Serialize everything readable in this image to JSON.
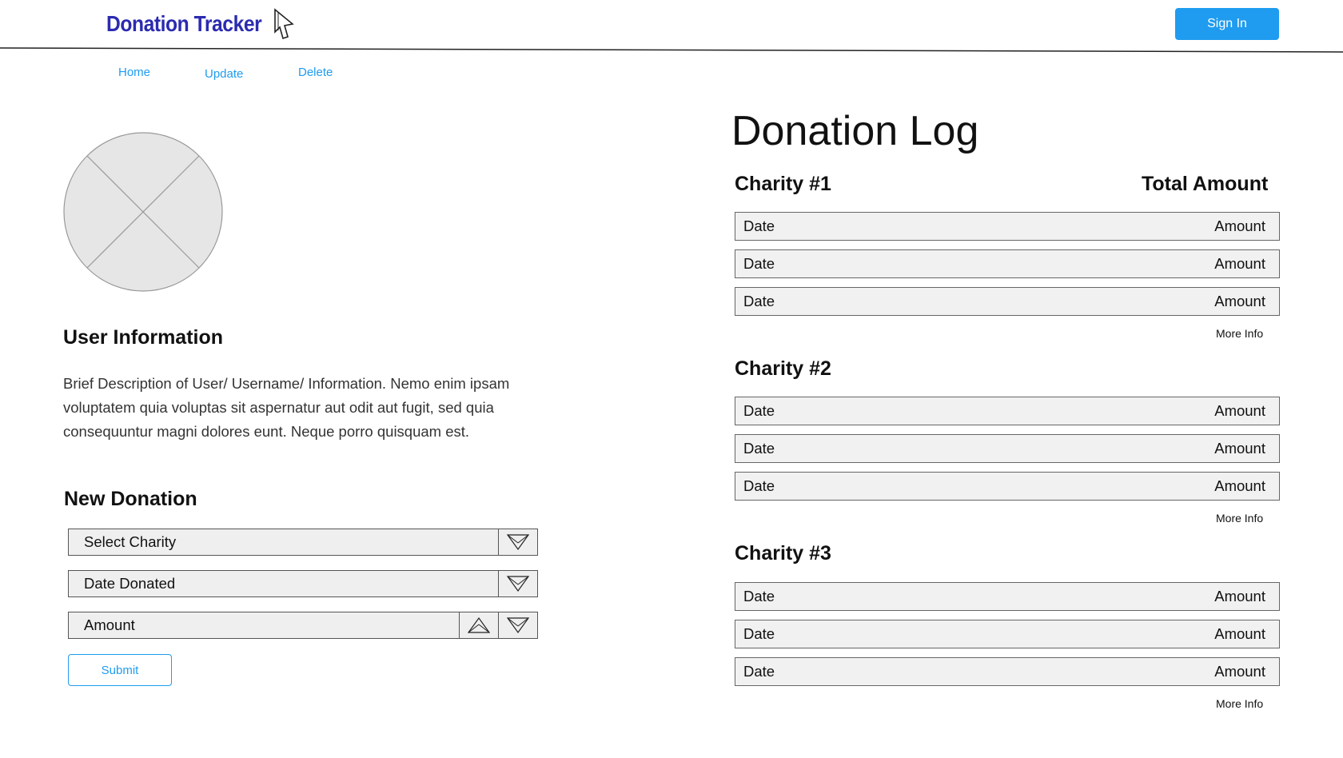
{
  "header": {
    "logo_text": "Donation Tracker",
    "sign_in_label": "Sign In"
  },
  "nav": {
    "items": [
      "Home",
      "Update",
      "Delete"
    ]
  },
  "user": {
    "heading": "User Information",
    "description": "Brief Description of User/ Username/ Information. Nemo enim ipsam voluptatem quia voluptas sit aspernatur aut odit aut fugit, sed quia consequuntur magni dolores eunt. Neque porro quisquam est."
  },
  "new_donation": {
    "heading": "New Donation",
    "select_charity": "Select Charity",
    "date_donated": "Date Donated",
    "amount": "Amount",
    "submit_label": "Submit"
  },
  "log": {
    "title": "Donation Log",
    "total_label": "Total Amount",
    "more_info_label": "More Info",
    "charities": [
      {
        "name": "Charity #1",
        "rows": [
          {
            "date": "Date",
            "amount": "Amount"
          },
          {
            "date": "Date",
            "amount": "Amount"
          },
          {
            "date": "Date",
            "amount": "Amount"
          }
        ]
      },
      {
        "name": "Charity #2",
        "rows": [
          {
            "date": "Date",
            "amount": "Amount"
          },
          {
            "date": "Date",
            "amount": "Amount"
          },
          {
            "date": "Date",
            "amount": "Amount"
          }
        ]
      },
      {
        "name": "Charity #3",
        "rows": [
          {
            "date": "Date",
            "amount": "Amount"
          },
          {
            "date": "Date",
            "amount": "Amount"
          },
          {
            "date": "Date",
            "amount": "Amount"
          }
        ]
      }
    ]
  },
  "colors": {
    "accent": "#1f9cef",
    "logo": "#2b2bb0"
  }
}
